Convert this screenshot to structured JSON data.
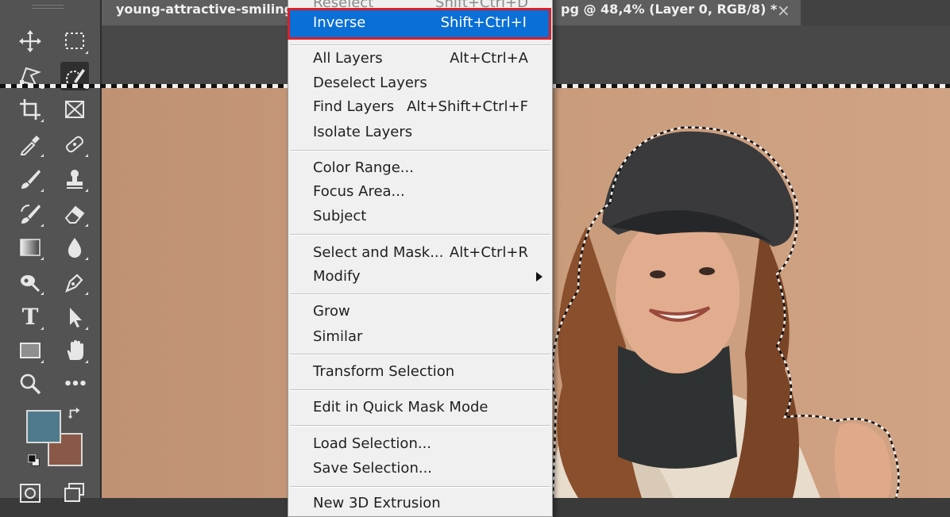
{
  "document": {
    "tab_left": "young-attractive-smiling",
    "tab_right": "pg @ 48,4% (Layer 0, RGB/8) *",
    "close_glyph": "×"
  },
  "toolbar": {
    "type_tool_glyph": "T",
    "more_tools_glyph": "•••",
    "foreground_color": "#4f7a8c",
    "background_color": "#8a5846",
    "tools": [
      "move-tool",
      "rectangular-marquee-tool",
      "magnetic-lasso-tool",
      "quick-selection-tool",
      "crop-tool",
      "frame-tool",
      "eyedropper-tool",
      "spot-healing-brush-tool",
      "brush-tool",
      "clone-stamp-tool",
      "history-brush-tool",
      "eraser-tool",
      "gradient-tool",
      "blur-tool",
      "dodge-tool",
      "pen-tool",
      "type-tool",
      "path-selection-tool",
      "rectangle-tool",
      "hand-tool",
      "zoom-tool",
      "edit-toolbar"
    ]
  },
  "menu": {
    "top_cut_label": "Reselect",
    "top_cut_shortcut": "Shift+Ctrl+D",
    "highlighted": {
      "label": "Inverse",
      "shortcut": "Shift+Ctrl+I"
    },
    "items": [
      {
        "label": "All Layers",
        "shortcut": "Alt+Ctrl+A"
      },
      {
        "label": "Deselect Layers",
        "shortcut": ""
      },
      {
        "label": "Find Layers",
        "shortcut": "Alt+Shift+Ctrl+F"
      },
      {
        "label": "Isolate Layers",
        "shortcut": ""
      },
      {
        "label": "Color Range...",
        "shortcut": ""
      },
      {
        "label": "Focus Area...",
        "shortcut": ""
      },
      {
        "label": "Subject",
        "shortcut": ""
      },
      {
        "label": "Select and Mask...",
        "shortcut": "Alt+Ctrl+R"
      },
      {
        "label": "Modify",
        "shortcut": ""
      },
      {
        "label": "Grow",
        "shortcut": ""
      },
      {
        "label": "Similar",
        "shortcut": ""
      },
      {
        "label": "Transform Selection",
        "shortcut": ""
      },
      {
        "label": "Edit in Quick Mask Mode",
        "shortcut": ""
      },
      {
        "label": "Load Selection...",
        "shortcut": ""
      },
      {
        "label": "Save Selection...",
        "shortcut": ""
      },
      {
        "label": "New 3D Extrusion",
        "shortcut": ""
      }
    ]
  },
  "colors": {
    "highlight": "#0a6fd6",
    "highlight_outline": "#d9202a",
    "menu_bg": "#f0f0f0",
    "toolbar_bg": "#535353",
    "canvas_bg": "#c99c7c"
  }
}
